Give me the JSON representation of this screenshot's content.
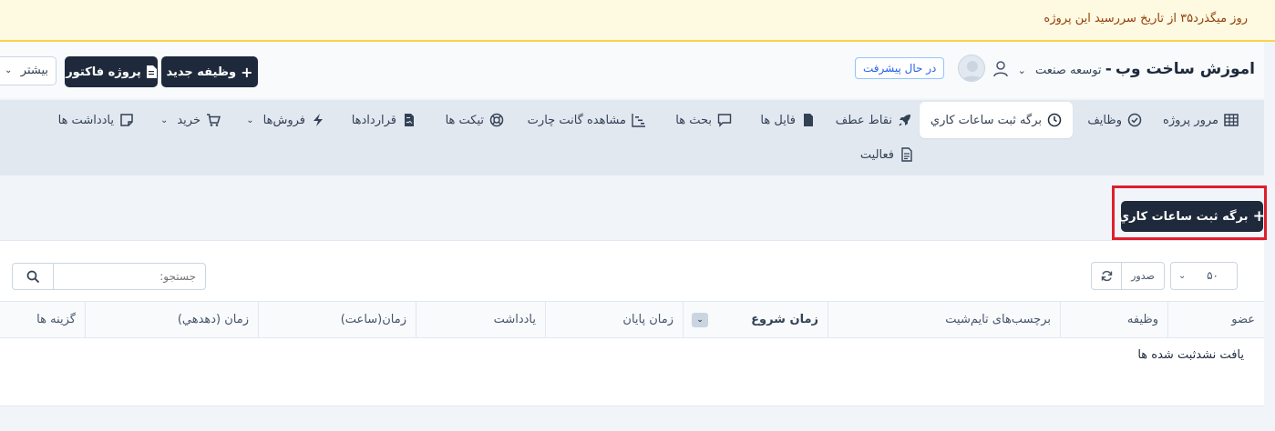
{
  "alert": {
    "text": "روز میگذرد۳۵ از تاریخ سررسید این پروژه"
  },
  "header": {
    "project_name": "اموزش ساخت وب",
    "separator": "-",
    "client_name": "توسعه صنعت",
    "status_badge": "در حال پیشرفت",
    "new_task_label": "وظیفه جدید",
    "invoice_label": "پروژه فاکتور",
    "more_label": "بیشتر"
  },
  "tabs": {
    "overview": "مرور پروژه",
    "tasks": "وظایف",
    "timesheets": "برگه ثبت ساعات کاري",
    "milestones": "نقاط عطف",
    "files": "فایل ها",
    "discussions": "بحث ها",
    "gantt": "مشاهده گانت چارت",
    "tickets": "تیکت ها",
    "contracts": "قراردادها",
    "sales": "فروش‌ها",
    "purchases": "خرید",
    "notes": "یادداشت ها",
    "activity": "فعالیت"
  },
  "timesheet_button": {
    "label": "برگه ثبت ساعات کاري"
  },
  "table_controls": {
    "page_size": "۵۰",
    "export_label": "صدور",
    "search_placeholder": "جستجو:"
  },
  "table": {
    "columns": {
      "member": "عضو",
      "task": "وظیفه",
      "tags": "برچسب‌های تایم‌شیت",
      "start_time": "زمان شروع",
      "end_time": "زمان پایان",
      "note": "یادداشت",
      "time_hours": "زمان(ساعت)",
      "time_decimal": "زمان (دهدهي)",
      "options": "گزینه ها"
    },
    "empty_message": "یافت نشدثبت شده ها"
  },
  "colors": {
    "accent_dark": "#1e293b",
    "alert_bg": "#fef9e1",
    "highlight_border": "#e11d2e",
    "status_blue": "#2563eb"
  }
}
